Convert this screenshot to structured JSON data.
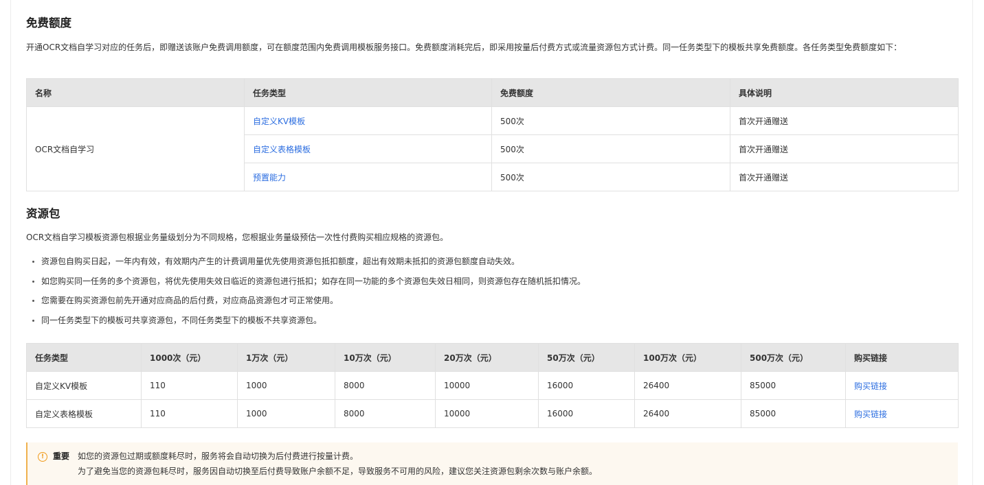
{
  "free_quota": {
    "heading": "免费额度",
    "paragraph": "开通OCR文档自学习对应的任务后，即赠送该账户免费调用额度，可在额度范围内免费调用模板服务接口。免费额度消耗完后，即采用按量后付费方式或流量资源包方式计费。同一任务类型下的模板共享免费额度。各任务类型免费额度如下：",
    "table": {
      "headers": [
        "名称",
        "任务类型",
        "免费额度",
        "具体说明"
      ],
      "name": "OCR文档自学习",
      "rows": [
        {
          "task_type": "自定义KV模板",
          "quota": "500次",
          "note": "首次开通赠送"
        },
        {
          "task_type": "自定义表格模板",
          "quota": "500次",
          "note": "首次开通赠送"
        },
        {
          "task_type": "预置能力",
          "quota": "500次",
          "note": "首次开通赠送"
        }
      ]
    }
  },
  "resource_pack": {
    "heading": "资源包",
    "intro": "OCR文档自学习模板资源包根据业务量级划分为不同规格，您根据业务量级预估一次性付费购买相应规格的资源包。",
    "bullets": [
      "资源包自购买日起，一年内有效，有效期内产生的计费调用量优先使用资源包抵扣额度，超出有效期未抵扣的资源包额度自动失效。",
      "如您购买同一任务的多个资源包，将优先使用失效日临近的资源包进行抵扣；如存在同一功能的多个资源包失效日相同，则资源包存在随机抵扣情况。",
      "您需要在购买资源包前先开通对应商品的后付费，对应商品资源包才可正常使用。",
      "同一任务类型下的模板可共享资源包，不同任务类型下的模板不共享资源包。"
    ],
    "table": {
      "headers": [
        "任务类型",
        "1000次（元）",
        "1万次（元）",
        "10万次（元）",
        "20万次（元）",
        "50万次（元）",
        "100万次（元）",
        "500万次（元）",
        "购买链接"
      ],
      "rows": [
        {
          "task_type": "自定义KV模板",
          "p1000": "110",
          "p1w": "1000",
          "p10w": "8000",
          "p20w": "10000",
          "p50w": "16000",
          "p100w": "26400",
          "p500w": "85000",
          "link": "购买链接"
        },
        {
          "task_type": "自定义表格模板",
          "p1000": "110",
          "p1w": "1000",
          "p10w": "8000",
          "p20w": "10000",
          "p50w": "16000",
          "p100w": "26400",
          "p500w": "85000",
          "link": "购买链接"
        }
      ]
    }
  },
  "notice": {
    "icon": "warning-circle-icon",
    "icon_glyph": "!",
    "title": "重要",
    "line1": "如您的资源包过期或额度耗尽时，服务将会自动切换为后付费进行按量计费。",
    "line2": "为了避免当您的资源包耗尽时，服务因自动切换至后付费导致账户余额不足，导致服务不可用的风险，建议您关注资源包剩余次数与账户余额。",
    "accent_color": "#f0b14d",
    "background_color": "#fdf8f0"
  },
  "colors": {
    "link": "#2b6de0",
    "table_header_bg": "#e6e6e6",
    "border": "#e0e0e0"
  }
}
